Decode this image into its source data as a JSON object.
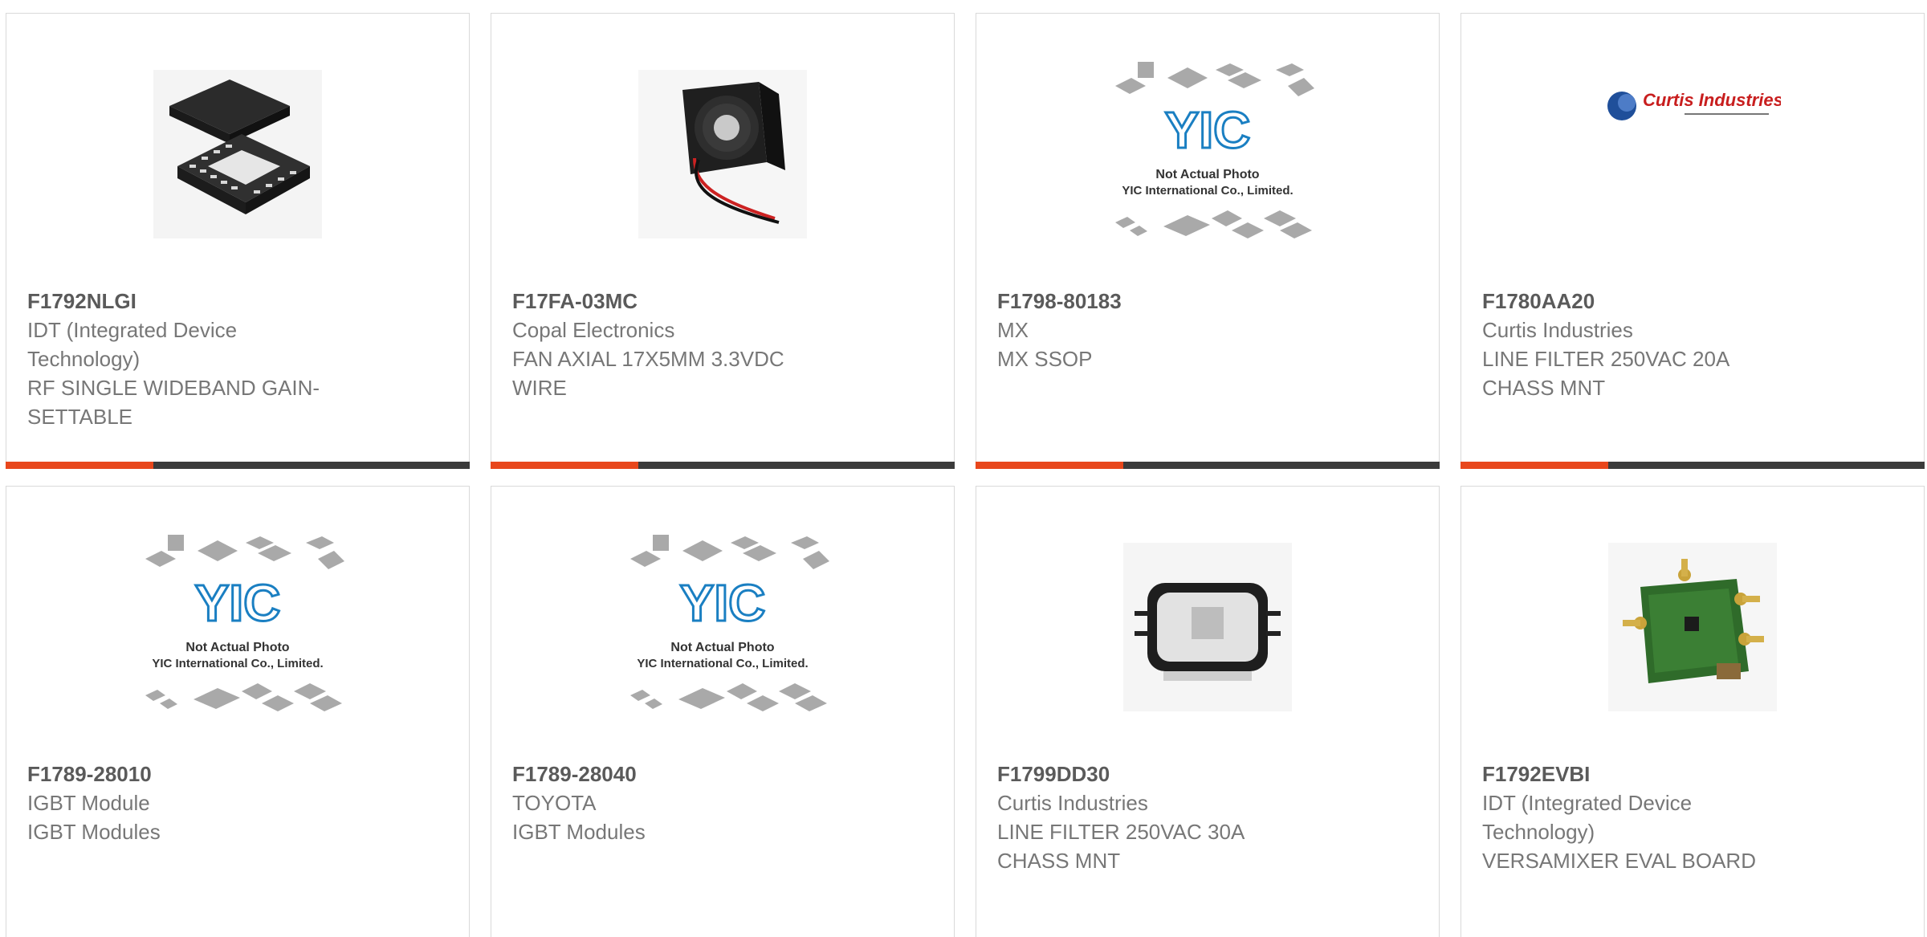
{
  "colors": {
    "accent": "#e8471c",
    "bar": "#3b3b3b",
    "part_number": "#5a5a5a",
    "text": "#777777",
    "border": "#d9d9d9"
  },
  "products": [
    {
      "part_number": "F1792NLGI",
      "manufacturer_lines": [
        "IDT (Integrated Device",
        "Technology)"
      ],
      "description_lines": [
        "RF SINGLE WIDEBAND GAIN-",
        "SETTABLE"
      ],
      "image": "qfn-chip-icon"
    },
    {
      "part_number": "F17FA-03MC",
      "manufacturer_lines": [
        "Copal Electronics"
      ],
      "description_lines": [
        "FAN AXIAL 17X5MM 3.3VDC",
        "WIRE"
      ],
      "image": "fan-icon"
    },
    {
      "part_number": "F1798-80183",
      "manufacturer_lines": [
        "MX"
      ],
      "description_lines": [
        "MX SSOP"
      ],
      "image": "yic-placeholder-icon",
      "placeholder_text": [
        "Not Actual Photo",
        "YIC International Co., Limited."
      ]
    },
    {
      "part_number": "F1780AA20",
      "manufacturer_lines": [
        "Curtis Industries"
      ],
      "description_lines": [
        "LINE FILTER 250VAC 20A",
        "CHASS MNT"
      ],
      "image": "curtis-logo-icon",
      "logo_text": "Curtis Industries"
    },
    {
      "part_number": "F1789-28010",
      "manufacturer_lines": [
        "IGBT Module"
      ],
      "description_lines": [
        "IGBT Modules"
      ],
      "image": "yic-placeholder-icon",
      "placeholder_text": [
        "Not Actual Photo",
        "YIC International Co., Limited."
      ]
    },
    {
      "part_number": "F1789-28040",
      "manufacturer_lines": [
        "TOYOTA"
      ],
      "description_lines": [
        "IGBT Modules"
      ],
      "image": "yic-placeholder-icon",
      "placeholder_text": [
        "Not Actual Photo",
        "YIC International Co., Limited."
      ]
    },
    {
      "part_number": "F1799DD30",
      "manufacturer_lines": [
        "Curtis Industries"
      ],
      "description_lines": [
        "LINE FILTER 250VAC 30A",
        "CHASS MNT"
      ],
      "image": "line-filter-icon"
    },
    {
      "part_number": "F1792EVBI",
      "manufacturer_lines": [
        "IDT (Integrated Device",
        "Technology)"
      ],
      "description_lines": [
        "VERSAMIXER EVAL BOARD"
      ],
      "image": "eval-board-icon"
    }
  ]
}
